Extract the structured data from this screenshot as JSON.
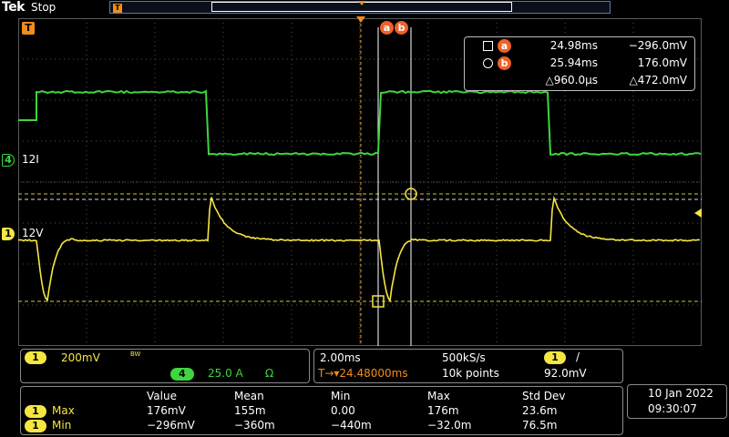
{
  "brand": "Tek",
  "acq_state": "Stop",
  "colors": {
    "ch1": "#f5e642",
    "ch4": "#3ed63e",
    "cursor": "#f0612a",
    "trigger": "#f28c1c",
    "grid": "#5a5a5a"
  },
  "markers": {
    "trigger_flag": "T",
    "ch4_number": "4",
    "ch4_label": "12I",
    "ch1_number": "1",
    "ch1_label": "12V",
    "cursor_a": "a",
    "cursor_b": "b"
  },
  "cursor_readout": {
    "a": {
      "label": "a",
      "time": "24.98ms",
      "value": "−296.0mV"
    },
    "b": {
      "label": "b",
      "time": "25.94ms",
      "value": "176.0mV"
    },
    "delta_time": "△960.0µs",
    "delta_value": "△472.0mV"
  },
  "vertical_panel": {
    "ch1_number": "1",
    "ch1_scale": "200mV",
    "ch1_bw": "BW",
    "ch4_number": "4",
    "ch4_scale": "25.0 A",
    "ch4_unit": "Ω"
  },
  "horizontal_panel": {
    "time_div": "2.00ms",
    "sample_rate": "500kS/s",
    "trigger_source": "1",
    "trigger_slope": "/",
    "trigger_pos": "T→▾24.48000ms",
    "record_length": "10k points",
    "trigger_level": "92.0mV"
  },
  "measurements": {
    "headers": [
      "Value",
      "Mean",
      "Min",
      "Max",
      "Std Dev"
    ],
    "rows": [
      {
        "channel": "1",
        "name": "Max",
        "values": [
          "176mV",
          "155m",
          "0.00",
          "176m",
          "23.6m"
        ]
      },
      {
        "channel": "1",
        "name": "Min",
        "values": [
          "−296mV",
          "−360m",
          "−440m",
          "−32.0m",
          "76.5m"
        ]
      }
    ]
  },
  "datetime": {
    "date": "10 Jan  2022",
    "time": "09:30:07"
  }
}
